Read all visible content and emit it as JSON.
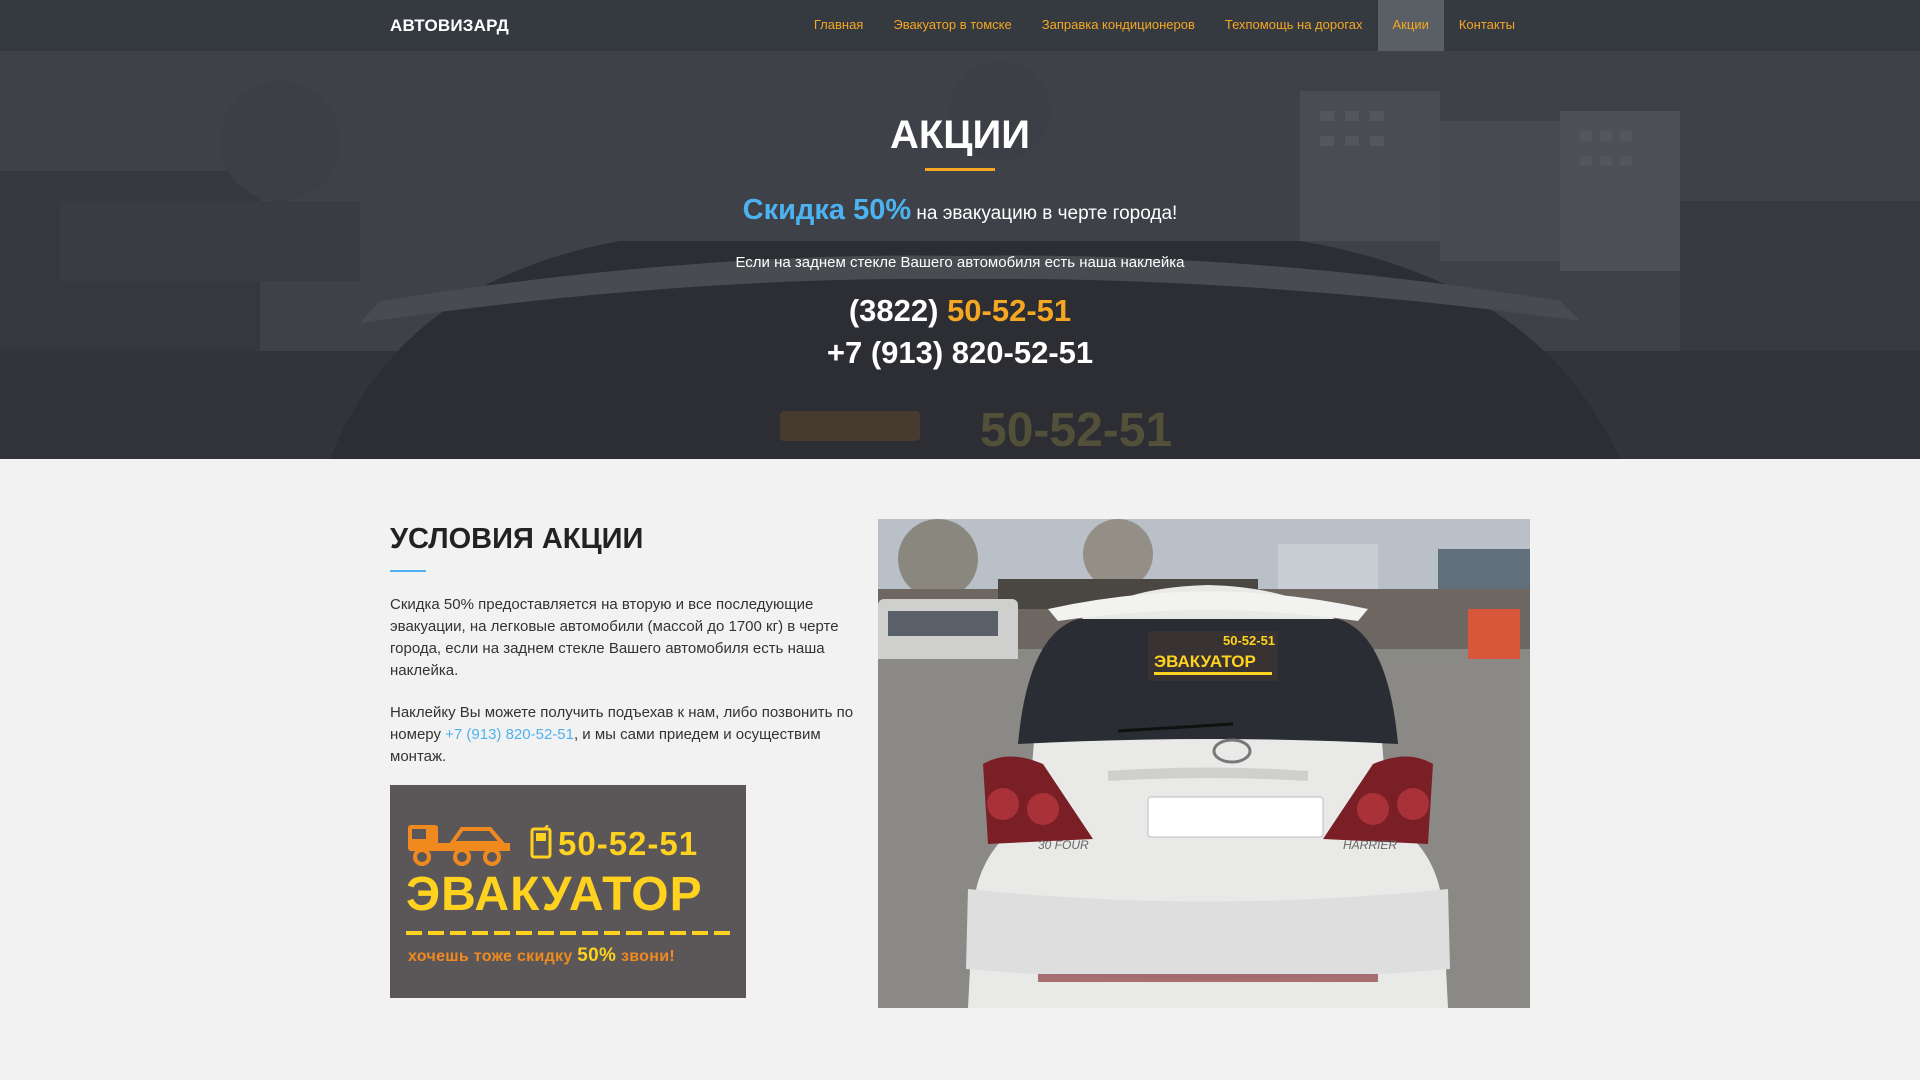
{
  "nav": {
    "brand": "АВТОВИЗАРД",
    "links": [
      {
        "label": "Главная"
      },
      {
        "label": "Эвакуатор в томске"
      },
      {
        "label": "Заправка кондиционеров"
      },
      {
        "label": "Техпомощь на дорогах"
      },
      {
        "label": "Акции",
        "active": true
      },
      {
        "label": "Контакты"
      }
    ]
  },
  "hero": {
    "title": "АКЦИИ",
    "promo_big": "Скидка 50%",
    "promo_rest": " на эвакуацию в черте города!",
    "subtitle": "Если на заднем стекле Вашего автомобиля есть наша наклейка",
    "phone1_code": "(3822) ",
    "phone1_number": "50-52-51",
    "phone2": "+7 (913) 820-52-51"
  },
  "conditions": {
    "title": "УСЛОВИЯ АКЦИИ",
    "para1": "Скидка 50% предоставляется на вторую и все последующие эвакуации, на легковые автомобили (массой до 1700 кг) в черте города, если на заднем стекле Вашего автомобиля есть наша наклейка.",
    "para2_before": "Наклейку Вы можете получить подъехав к нам, либо позвонить по номеру ",
    "para2_link": "+7 (913) 820-52-51",
    "para2_after": ", и мы сами приедем и осуществим монтаж."
  },
  "sticker": {
    "phone": "50-52-51",
    "word": "ЭВАКУАТОР",
    "slogan_before": "хочешь тоже скидку ",
    "slogan_pct": "50%",
    "slogan_after": " звони!"
  },
  "photo": {
    "sticker_phone": "50-52-51",
    "sticker_word": "ЭВАКУАТОР",
    "model_left": "30 FOUR",
    "model_right": "HARRIER"
  },
  "colors": {
    "nav_bg": "#343a40",
    "nav_link": "#f5a623",
    "accent_blue": "#4db3f0",
    "accent_orange": "#f5a623",
    "sticker_yellow": "#ffd21f"
  }
}
